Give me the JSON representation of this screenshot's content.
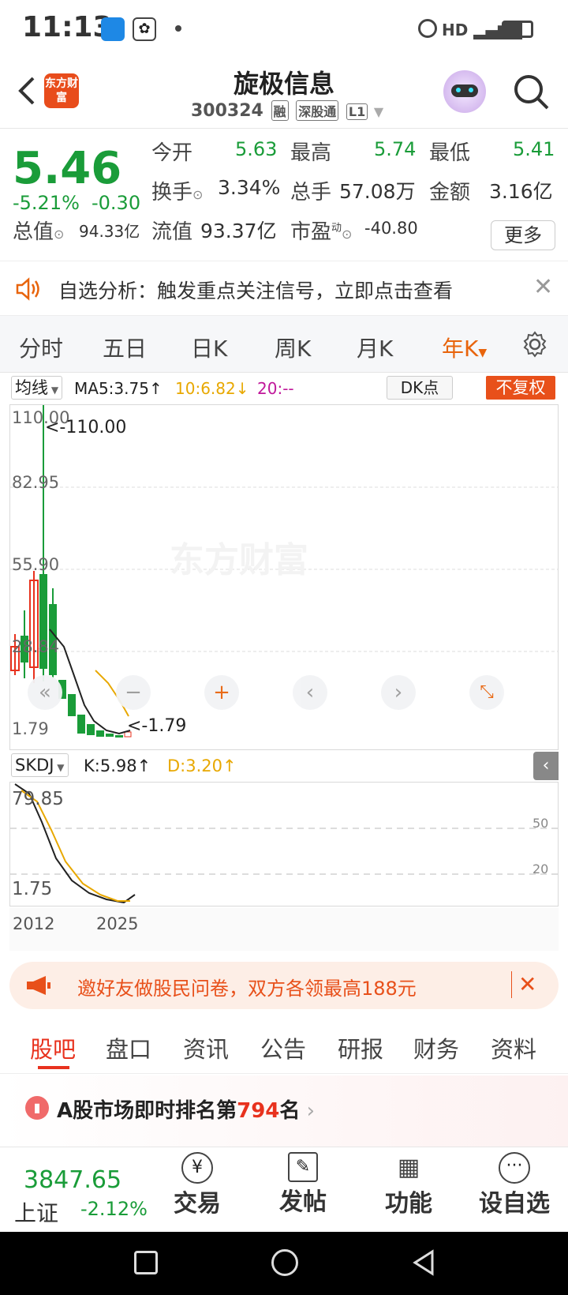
{
  "status": {
    "time": "11:13"
  },
  "header": {
    "name": "旋极信息",
    "code": "300324",
    "tags": [
      "融",
      "深股通",
      "L1"
    ],
    "logo_text": "东方财富"
  },
  "quote": {
    "price": "5.46",
    "change_pct": "-5.21%",
    "change": "-0.30",
    "open_label": "今开",
    "open": "5.63",
    "high_label": "最高",
    "high": "5.74",
    "low_label": "最低",
    "low": "5.41",
    "turnover_label": "换手",
    "turnover": "3.34%",
    "volume_label": "总手",
    "volume": "57.08万",
    "amount_label": "金额",
    "amount": "3.16亿",
    "mktcap_label": "总值",
    "mktcap": "94.33亿",
    "float_label": "流值",
    "float": "93.37亿",
    "pe_label": "市盈",
    "pe_sup": "动",
    "pe": "-40.80",
    "more": "更多"
  },
  "notice": {
    "text": "自选分析：触发重点关注信号，立即点击查看"
  },
  "tabs": [
    "分时",
    "五日",
    "日K",
    "周K",
    "月K",
    "年K"
  ],
  "active_tab": "年K",
  "indicator": {
    "ma_select": "均线",
    "ma5": "MA5:3.75",
    "ma10": "10:6.82",
    "ma20": "20:--",
    "dk": "DK点",
    "adjust": "不复权"
  },
  "chart_data": {
    "type": "candlestick",
    "y_ticks": [
      "110.00",
      "82.95",
      "55.90",
      "28.84",
      "1.79"
    ],
    "max_label": "<-110.00",
    "min_label": "<-1.79",
    "ylim": [
      1.79,
      110.0
    ],
    "x_labels": [
      "2012",
      "2025"
    ],
    "watermark": "东方财富"
  },
  "skdj": {
    "select": "SKDJ",
    "k": "K:5.98",
    "d": "D:3.20",
    "top": "79.85",
    "bottom": "1.75",
    "level50": "50",
    "level20": "20"
  },
  "invite": {
    "text": "邀好友做股民问卷，双方各领最高188元"
  },
  "bottom_tabs": [
    "股吧",
    "盘口",
    "资讯",
    "公告",
    "研报",
    "财务",
    "资料"
  ],
  "rank": {
    "prefix": "A股市场即时排名第",
    "number": "794",
    "suffix": "名"
  },
  "index": {
    "value": "3847.65",
    "name": "上证",
    "change": "-2.12%"
  },
  "bottom_bar": [
    "交易",
    "发帖",
    "功能",
    "设自选"
  ]
}
